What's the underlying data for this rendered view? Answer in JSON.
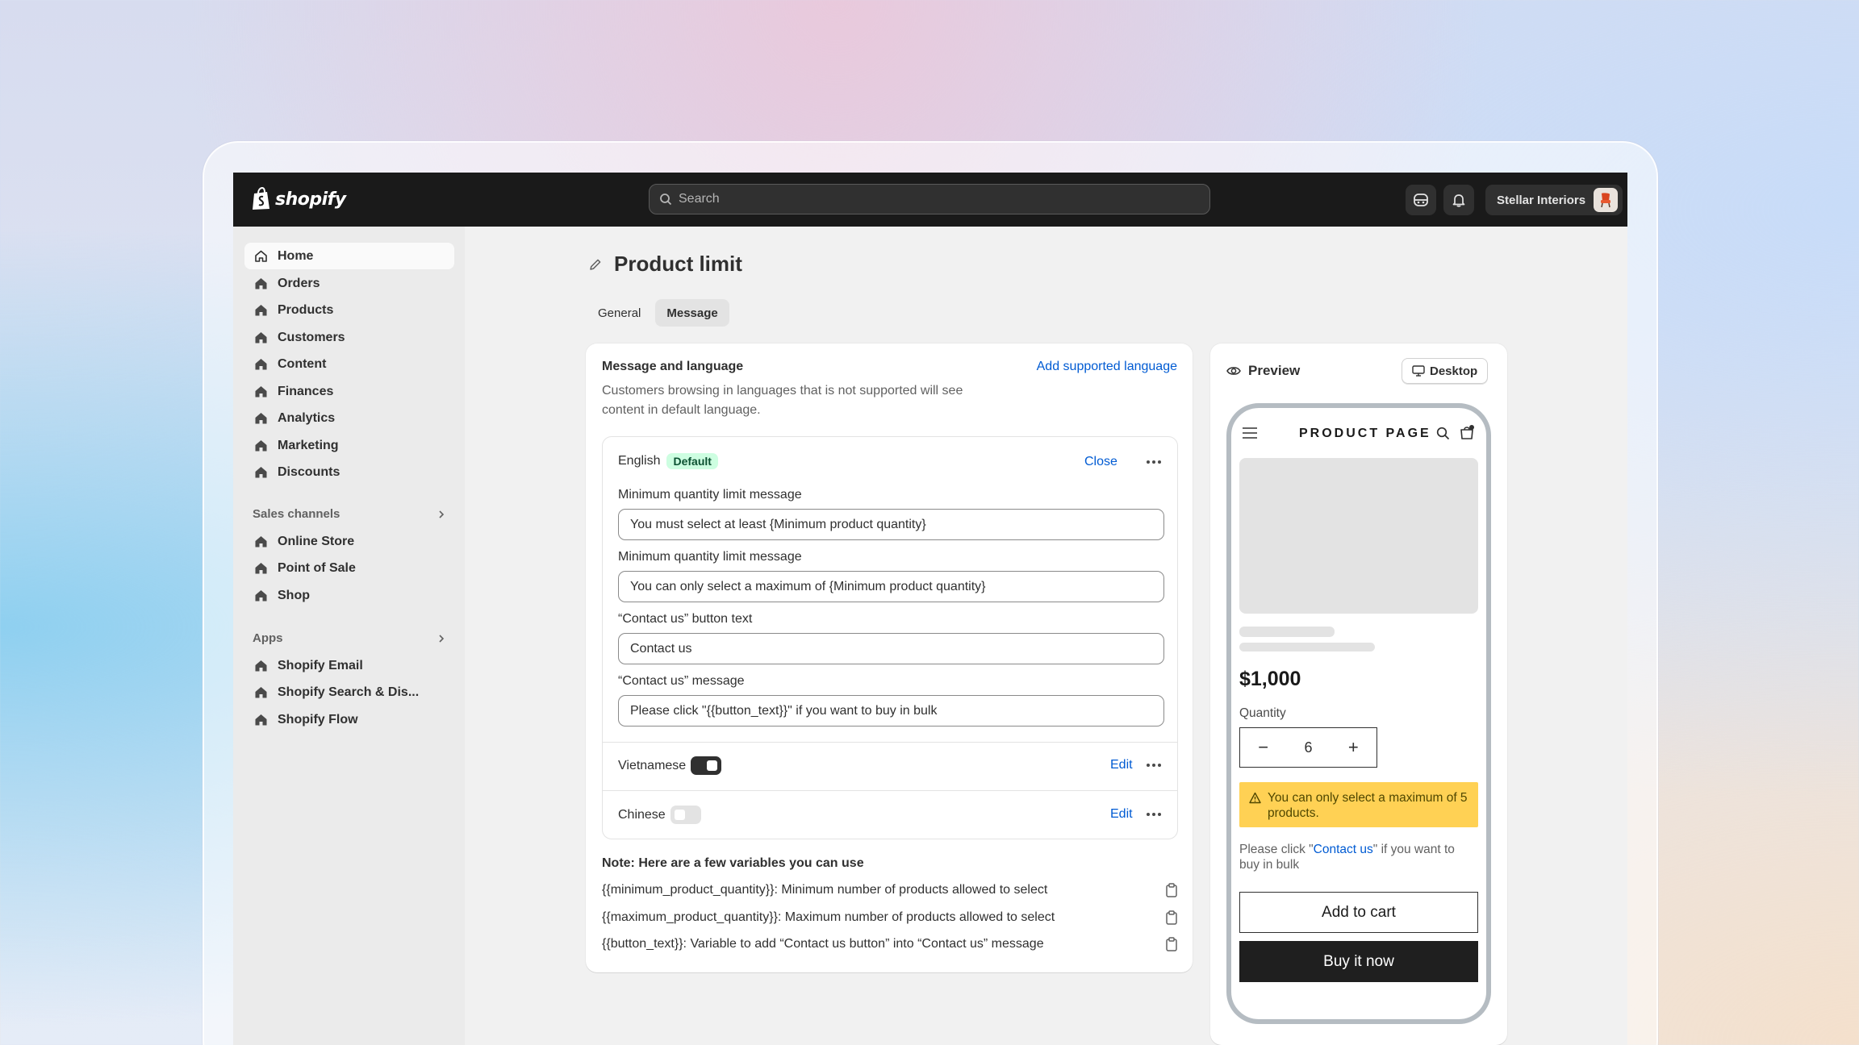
{
  "topbar": {
    "logo_text": "shopify",
    "search_placeholder": "Search",
    "store_name": "Stellar Interiors"
  },
  "sidebar": {
    "items": [
      "Home",
      "Orders",
      "Products",
      "Customers",
      "Content",
      "Finances",
      "Analytics",
      "Marketing",
      "Discounts"
    ],
    "sales_channels_label": "Sales channels",
    "channels": [
      "Online Store",
      "Point of Sale",
      "Shop"
    ],
    "apps_label": "Apps",
    "apps": [
      "Shopify Email",
      "Shopify Search & Dis...",
      "Shopify Flow"
    ]
  },
  "page": {
    "title": "Product limit",
    "tabs": [
      "General",
      "Message"
    ],
    "active_tab": "Message"
  },
  "message_card": {
    "title": "Message and language",
    "add_language_link": "Add supported language",
    "subtitle": "Customers browsing in languages that is not supported will see content in default language.",
    "english": {
      "label": "English",
      "badge": "Default",
      "close_link": "Close",
      "fields": [
        {
          "label": "Minimum quantity limit message",
          "value": "You must select at least {Minimum product quantity}"
        },
        {
          "label": "Minimum quantity limit message",
          "value": "You can only select a maximum of {Minimum product quantity}"
        },
        {
          "label": "“Contact us” button text",
          "value": "Contact us"
        },
        {
          "label": "“Contact us” message",
          "value": "Please click \"{{button_text}}\" if you want to buy in bulk"
        }
      ]
    },
    "languages": [
      {
        "label": "Vietnamese",
        "enabled": true,
        "edit": "Edit"
      },
      {
        "label": "Chinese",
        "enabled": false,
        "edit": "Edit"
      }
    ],
    "note_title": "Note: Here are a few variables you can use",
    "variables": [
      "{{minimum_product_quantity}}: Minimum number of products allowed to select",
      "{{maximum_product_quantity}}: Maximum number of products allowed to select",
      "{{button_text}}: Variable to add “Contact us button” into “Contact us” message"
    ]
  },
  "preview": {
    "title": "Preview",
    "device_button": "Desktop",
    "page_title": "PRODUCT PAGE",
    "price": "$1,000",
    "quantity_label": "Quantity",
    "quantity_value": "6",
    "minus": "−",
    "plus": "+",
    "warning": "You can only select a maximum of 5 products.",
    "contact_prefix": "Please click \"",
    "contact_link": "Contact us",
    "contact_suffix": "\" if you want to buy in bulk",
    "add_to_cart": "Add to cart",
    "buy_now": "Buy it now"
  },
  "colors": {
    "topbar": "#1a1a1a",
    "link": "#005bd3",
    "badge_bg": "#cdfee1",
    "warning_bg": "#ffd154"
  }
}
